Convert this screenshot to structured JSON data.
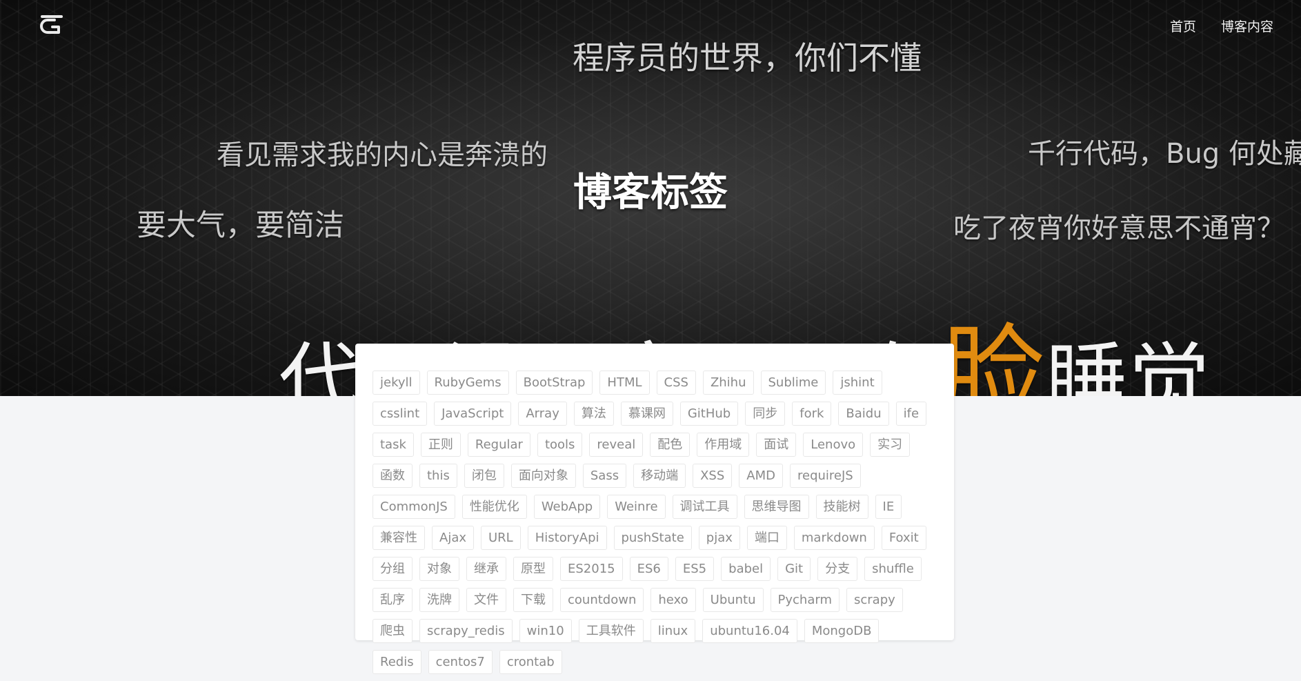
{
  "nav": {
    "home": "首页",
    "blog": "博客内容"
  },
  "hero": {
    "title": "博客标签",
    "slogans": {
      "top": "程序员的世界，你们不懂",
      "left_mid": "看见需求我的内心是奔溃的",
      "right_mid": "千行代码，Bug 何处藏",
      "left_low": "要大气，要简洁",
      "right_low": "吃了夜宵你好意思不通宵？",
      "big_pre": "代码没写完，哪有",
      "big_accent": "脸",
      "big_post": "睡觉"
    },
    "accent_color": "#e08b10"
  },
  "tags": [
    "jekyll",
    "RubyGems",
    "BootStrap",
    "HTML",
    "CSS",
    "Zhihu",
    "Sublime",
    "jshint",
    "csslint",
    "JavaScript",
    "Array",
    "算法",
    "慕课网",
    "GitHub",
    "同步",
    "fork",
    "Baidu",
    "ife",
    "task",
    "正则",
    "Regular",
    "tools",
    "reveal",
    "配色",
    "作用域",
    "面试",
    "Lenovo",
    "实习",
    "函数",
    "this",
    "闭包",
    "面向对象",
    "Sass",
    "移动端",
    "XSS",
    "AMD",
    "requireJS",
    "CommonJS",
    "性能优化",
    "WebApp",
    "Weinre",
    "调试工具",
    "思维导图",
    "技能树",
    "IE",
    "兼容性",
    "Ajax",
    "URL",
    "HistoryApi",
    "pushState",
    "pjax",
    "端口",
    "markdown",
    "Foxit",
    "分组",
    "对象",
    "继承",
    "原型",
    "ES2015",
    "ES6",
    "ES5",
    "babel",
    "Git",
    "分支",
    "shuffle",
    "乱序",
    "洗牌",
    "文件",
    "下载",
    "countdown",
    "hexo",
    "Ubuntu",
    "Pycharm",
    "scrapy",
    "爬虫",
    "scrapy_redis",
    "win10",
    "工具软件",
    "linux",
    "ubuntu16.04",
    "MongoDB",
    "Redis",
    "centos7",
    "crontab"
  ]
}
